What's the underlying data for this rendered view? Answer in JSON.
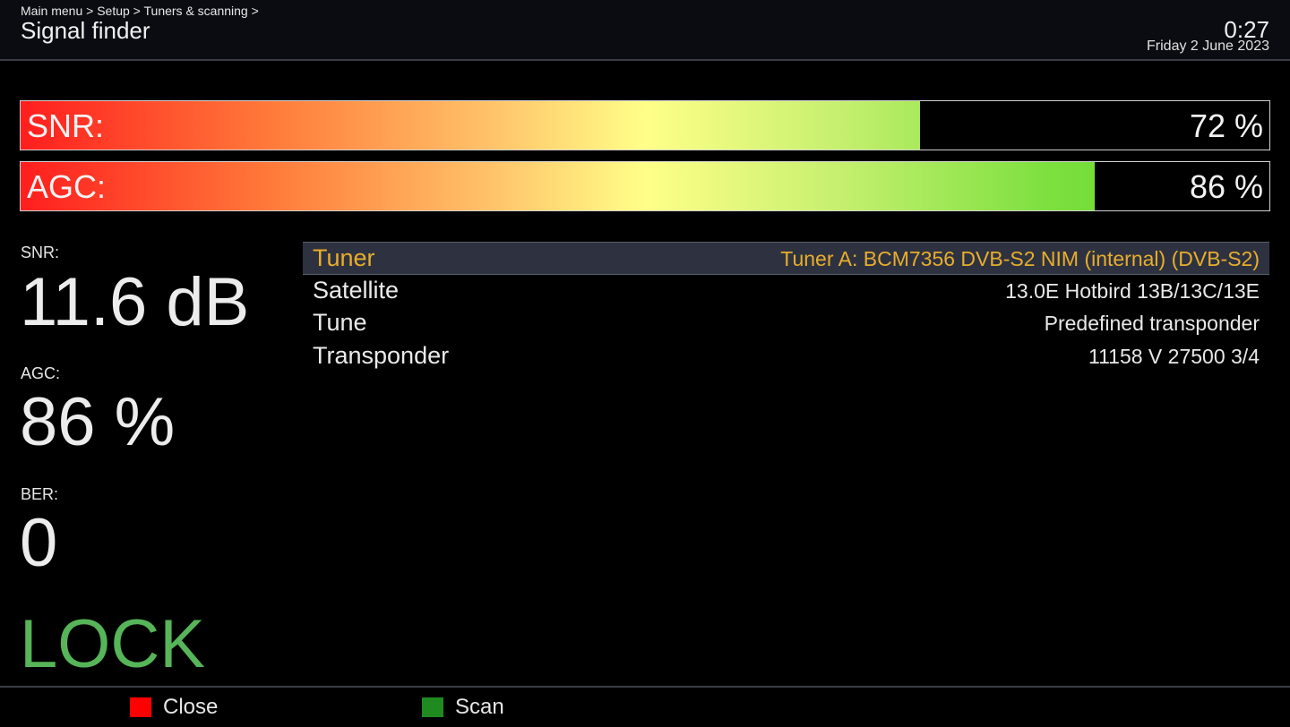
{
  "header": {
    "breadcrumb": "Main menu > Setup > Tuners & scanning >",
    "title": "Signal finder",
    "time": "0:27",
    "date": "Friday  2 June 2023"
  },
  "bars": {
    "snr": {
      "label": "SNR:",
      "value": "72 %",
      "level": 0.72
    },
    "agc": {
      "label": "AGC:",
      "value": "86 %",
      "level": 0.86
    }
  },
  "stats": {
    "snr": {
      "label": "SNR:",
      "value": "11.6 dB"
    },
    "agc": {
      "label": "AGC:",
      "value": "86 %"
    },
    "ber": {
      "label": "BER:",
      "value": "0"
    },
    "lock": "LOCK"
  },
  "info": [
    {
      "key": "Tuner",
      "value": "Tuner A: BCM7356 DVB-S2 NIM (internal) (DVB-S2)"
    },
    {
      "key": "Satellite",
      "value": "13.0E Hotbird 13B/13C/13E"
    },
    {
      "key": "Tune",
      "value": "Predefined transponder"
    },
    {
      "key": "Transponder",
      "value": "11158 V 27500 3/4"
    }
  ],
  "footer": {
    "red": {
      "label": "Close",
      "color": "#ff0000"
    },
    "green": {
      "label": "Scan",
      "color": "#1f8a1f"
    }
  },
  "colors": {
    "selected_text": "#e8ad2c",
    "lock": "#56b558"
  }
}
